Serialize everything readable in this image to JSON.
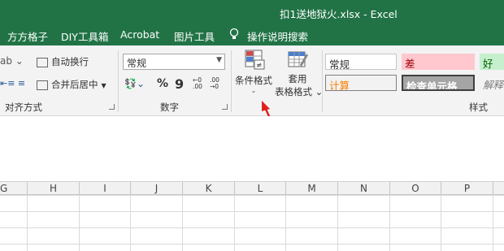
{
  "window": {
    "title": "扣1送地狱火.xlsx  -  Excel"
  },
  "menu": {
    "items": [
      "方方格子",
      "DIY工具箱",
      "Acrobat",
      "图片工具",
      "操作说明搜索"
    ]
  },
  "alignment": {
    "wrap_text": "自动换行",
    "merge_center": "合并后居中",
    "group_label": "对齐方式"
  },
  "number": {
    "format_value": "常规",
    "percent": "%",
    "comma": "9",
    "inc_decimal": "←0 .00",
    "dec_decimal": ".00 →0",
    "group_label": "数字"
  },
  "styles": {
    "conditional_formatting": "条件格式",
    "format_as_table_line1": "套用",
    "format_as_table_line2": "表格格式",
    "cells": [
      "常规",
      "差",
      "好",
      "计算",
      "检查单元格",
      "解释"
    ],
    "group_label": "样式",
    "colors": {
      "bad_bg": "#ffc7ce",
      "bad_fg": "#9c0006",
      "good_bg": "#c6efce",
      "good_fg": "#006100",
      "calc_fg": "#fa7d00",
      "check_bg": "#a5a5a5"
    }
  },
  "columns": [
    "G",
    "H",
    "I",
    "J",
    "K",
    "L",
    "M",
    "N",
    "O",
    "P"
  ],
  "accent": "#217346"
}
